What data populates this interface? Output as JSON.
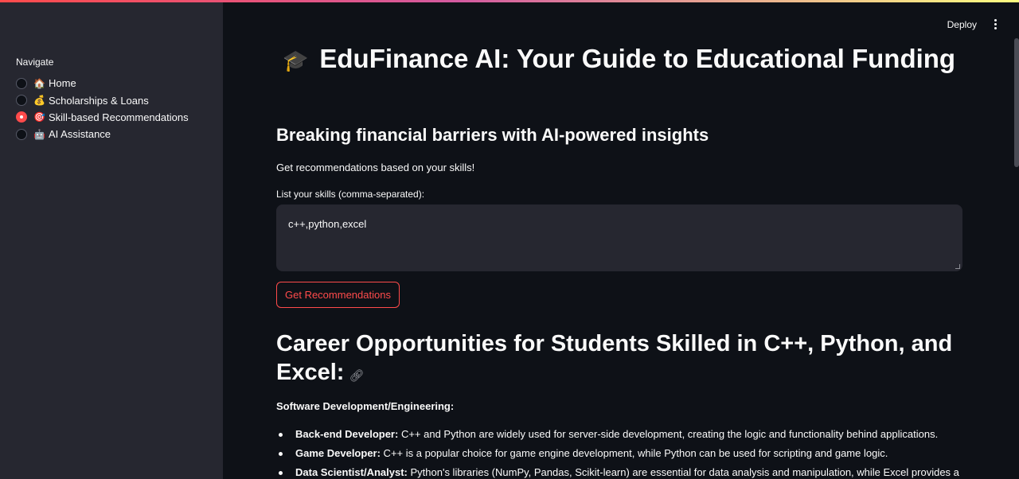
{
  "sidebar": {
    "nav_title": "Navigate",
    "items": [
      {
        "emoji": "🏠",
        "label": "Home",
        "selected": false
      },
      {
        "emoji": "💰",
        "label": "Scholarships & Loans",
        "selected": false
      },
      {
        "emoji": "🎯",
        "label": "Skill-based Recommendations",
        "selected": true
      },
      {
        "emoji": "🤖",
        "label": "AI Assistance",
        "selected": false
      }
    ]
  },
  "header": {
    "deploy_label": "Deploy"
  },
  "main": {
    "title_emoji": "🎓",
    "title": "EduFinance AI: Your Guide to Educational Funding",
    "subtitle": "Breaking financial barriers with AI-powered insights",
    "description": "Get recommendations based on your skills!",
    "skills_label": "List your skills (comma-separated):",
    "skills_value": "c++,python,excel",
    "button_label": "Get Recommendations",
    "career_heading": "Career Opportunities for Students Skilled in C++, Python, and Excel:",
    "section_label": "Software Development/Engineering:",
    "careers": [
      {
        "title": "Back-end Developer:",
        "text": " C++ and Python are widely used for server-side development, creating the logic and functionality behind applications."
      },
      {
        "title": "Game Developer:",
        "text": " C++ is a popular choice for game engine development, while Python can be used for scripting and game logic."
      },
      {
        "title": "Data Scientist/Analyst:",
        "text": " Python's libraries (NumPy, Pandas, Scikit-learn) are essential for data analysis and manipulation, while Excel provides a"
      }
    ]
  },
  "colors": {
    "accent": "#ff4b4b",
    "background": "#0e1117",
    "sidebar": "#262730"
  }
}
